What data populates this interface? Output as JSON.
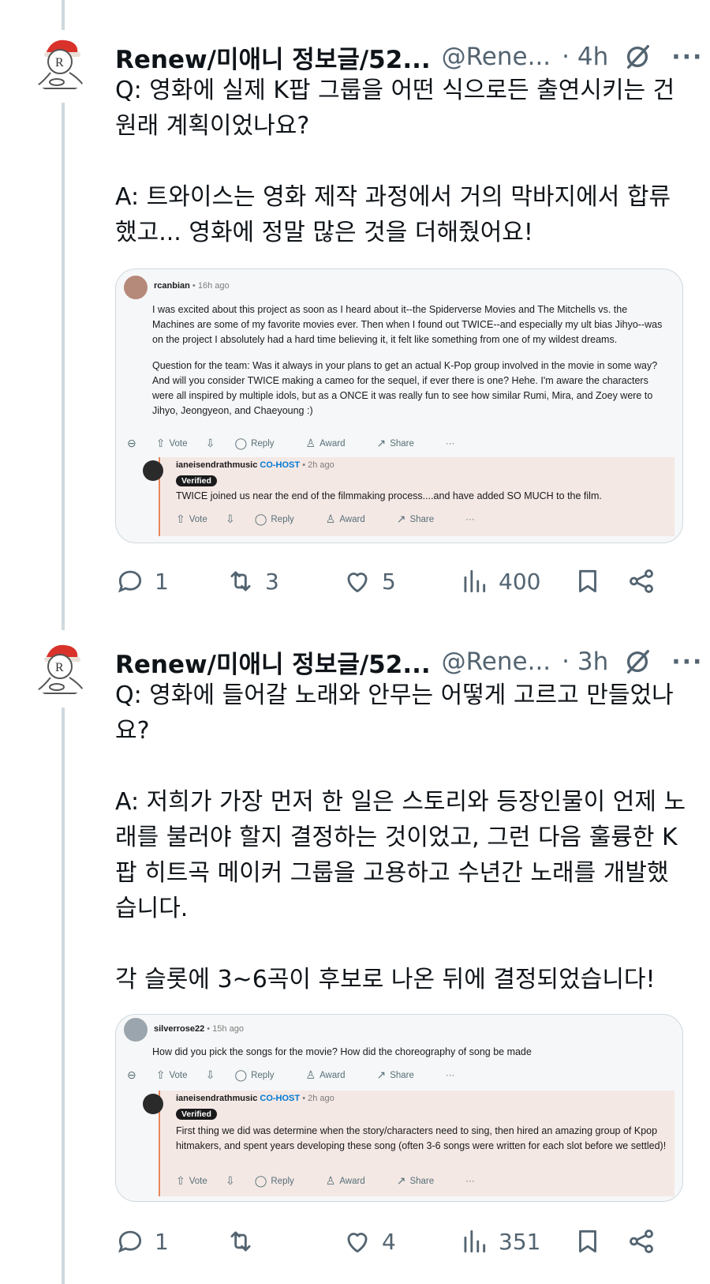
{
  "tweets": [
    {
      "name": "Renew/미애니 정보글/52...",
      "handle": "@Rene...",
      "time": "· 4h",
      "text": {
        "q": [
          "Q: 영화에 실제 K팝 그룹을 어떤 식으로든 출연시키는 건",
          "원래 계획이었나요?"
        ],
        "a": [
          "A: 트와이스는 영화 제작 과정에서 거의 막바지에서 합류",
          "했고... 영화에 정말 많은 것을 더해줬어요!"
        ]
      },
      "embed": {
        "comment_author": "rcanbian",
        "comment_ago": "• 16h ago",
        "comment_paragraphs": [
          "I was excited about this project as soon as I heard about it--the Spiderverse Movies and The Mitchells vs. the Machines are some of my favorite movies ever. Then when I found out TWICE--and especially my ult bias Jihyo--was on the project I absolutely had a hard time believing it, it felt like something from one of my wildest dreams.",
          "Question for the team: Was it always in your plans to get an actual K-Pop group involved in the movie in some way? And will you consider TWICE making a cameo for the sequel, if ever there is one? Hehe. I'm aware the characters were all inspired by multiple idols, but as a ONCE it was really fun to see how similar Rumi, Mira, and Zoey were to Jihyo, Jeongyeon, and Chaeyoung :)"
        ],
        "reply_author": "ianeisendrathmusic",
        "reply_role": "CO-HOST",
        "reply_ago": "• 2h ago",
        "verified": "Verified",
        "reply_text": "TWICE joined us near the end of the filmmaking process....and have added SO MUCH to the film."
      },
      "stats": {
        "replies": "1",
        "retweets": "3",
        "likes": "5",
        "views": "400"
      }
    },
    {
      "name": "Renew/미애니 정보글/52...",
      "handle": "@Rene...",
      "time": "· 3h",
      "text": {
        "q": [
          "Q: 영화에 들어갈 노래와 안무는 어떻게 고르고 만들었나",
          "요?"
        ],
        "a": [
          "A: 저희가 가장 먼저 한 일은 스토리와 등장인물이 언제 노",
          "래를 불러야 할지 결정하는 것이었고, 그런 다음 훌륭한 K",
          "팝 히트곡 메이커 그룹을 고용하고 수년간 노래를 개발했",
          "습니다."
        ],
        "b": [
          "각 슬롯에 3~6곡이 후보로 나온 뒤에 결정되었습니다!"
        ]
      },
      "embed": {
        "comment_author": "silverrose22",
        "comment_ago": "• 15h ago",
        "comment_paragraphs": [
          "How did you pick the songs for the movie? How did the choreography of song be made"
        ],
        "reply_author": "ianeisendrathmusic",
        "reply_role": "CO-HOST",
        "reply_ago": "• 2h ago",
        "verified": "Verified",
        "reply_text": "First thing we did was determine when the story/characters need to sing, then hired an amazing group of Kpop hitmakers, and spent years developing these song (often 3-6 songs were written for each slot before we settled)!"
      },
      "stats": {
        "replies": "1",
        "retweets": "",
        "likes": "4",
        "views": "351"
      }
    }
  ],
  "comment_actions": {
    "vote": "Vote",
    "reply": "Reply",
    "award": "Award",
    "share": "Share",
    "more": "···"
  },
  "icons": {
    "more": "···",
    "reply": "speech-bubble-icon",
    "retweet": "retweet-icon",
    "like": "heart-icon",
    "views": "bar-chart-icon",
    "bookmark": "bookmark-icon",
    "share": "share-icon",
    "grok": "grok-icon"
  },
  "colors": {
    "text": "#0f1419",
    "muted": "#536471",
    "thread": "#cfd9de",
    "cohost": "#0079d3",
    "reply_bg": "#f4e8e5",
    "reply_border": "#e8875a"
  }
}
